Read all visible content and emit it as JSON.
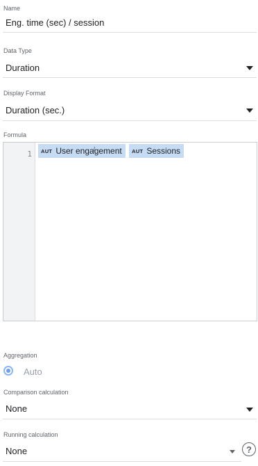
{
  "name_field": {
    "label": "Name",
    "value": "Eng. time (sec) / session"
  },
  "data_type": {
    "label": "Data Type",
    "value": "Duration"
  },
  "display_format": {
    "label": "Display Format",
    "value": "Duration (sec.)"
  },
  "formula": {
    "label": "Formula",
    "line_number": "1",
    "tokens": [
      {
        "badge": "AUT",
        "text": "User engagement"
      },
      {
        "badge": "AUT",
        "text": "Sessions"
      }
    ],
    "operator": "/"
  },
  "aggregation": {
    "label": "Aggregation",
    "option": "Auto"
  },
  "comparison_calculation": {
    "label": "Comparison calculation",
    "value": "None"
  },
  "running_calculation": {
    "label": "Running calculation",
    "value": "None"
  },
  "icons": {
    "dropdown": "chevron-down-icon",
    "help": "help-icon"
  }
}
